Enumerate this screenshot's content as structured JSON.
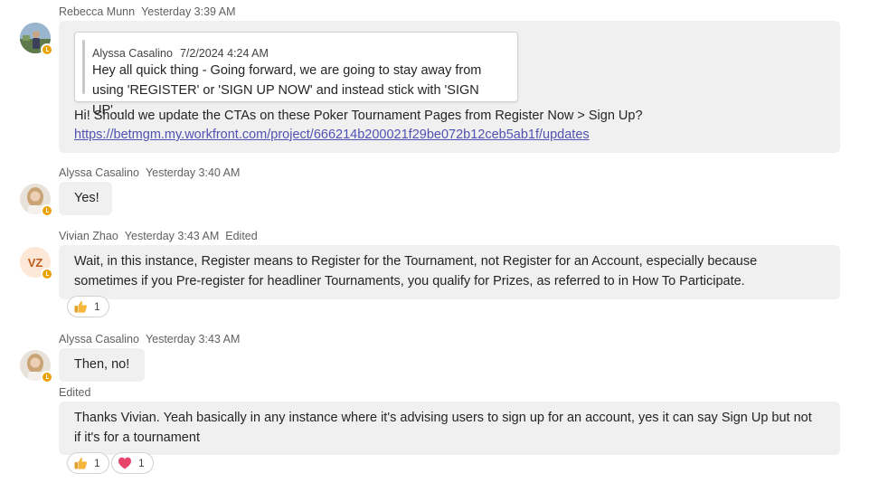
{
  "messages": [
    {
      "author": "Rebecca Munn",
      "time": "Yesterday 3:39 AM",
      "quote": {
        "author": "Alyssa Casalino",
        "time": "7/2/2024 4:24 AM",
        "line1": "Hey all quick thing - Going forward, we are going to stay away from",
        "line2": "using 'REGISTER' or 'SIGN UP NOW' and instead stick with 'SIGN UP'..."
      },
      "text": "Hi! Should we update the CTAs on these Poker Tournament Pages from Register Now > Sign Up?",
      "link": "https://betmgm.my.workfront.com/project/666214b200021f29be072b12ceb5ab1f/updates"
    },
    {
      "author": "Alyssa Casalino",
      "time": "Yesterday 3:40 AM",
      "text": "Yes!"
    },
    {
      "author": "Vivian Zhao",
      "initials": "VZ",
      "time": "Yesterday 3:43 AM",
      "edited": "Edited",
      "line1": "Wait, in this instance, Register means to Register for the Tournament, not Register for an Account, especially because",
      "line2": "sometimes if you Pre-register for headliner Tournaments, you qualify for Prizes, as referred to in How To Participate.",
      "reactions": [
        {
          "emoji": "thumbs-up",
          "count": "1"
        }
      ]
    },
    {
      "author": "Alyssa Casalino",
      "time": "Yesterday 3:43 AM",
      "text": "Then, no!"
    },
    {
      "edited": "Edited",
      "line1": "Thanks Vivian. Yeah basically in any instance where it's advising users to sign up for an account, yes it can say Sign Up but not",
      "line2": "if it's for a tournament",
      "reactions": [
        {
          "emoji": "thumbs-up",
          "count": "1"
        },
        {
          "emoji": "heart",
          "count": "1"
        }
      ]
    }
  ],
  "colors": {
    "bubble": "#f0f0f0",
    "link": "#4f52b2",
    "status_away": "#eaa300",
    "vz_avatar_bg": "#fde7d6",
    "vz_avatar_text": "#c05a1a"
  }
}
